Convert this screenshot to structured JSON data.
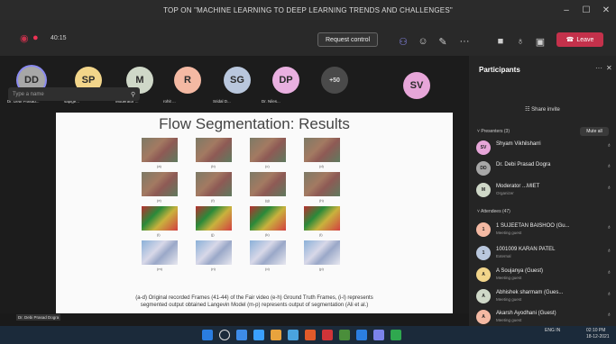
{
  "window": {
    "title": "TOP ON \"MACHINE LEARNING TO DEEP LEARNING TRENDS AND CHALLENGES\"",
    "minimize": "–",
    "maximize": "☐",
    "close": "✕"
  },
  "toolbar": {
    "timer": "40:15",
    "request_control": "Request control",
    "leave_label": "Leave",
    "more": "···"
  },
  "avatars": [
    {
      "initials": "DD",
      "name": "Dr. Debi Prasad...",
      "color": "#a7a7a7"
    },
    {
      "initials": "SP",
      "name": "sapige...",
      "color": "#f2d58a"
    },
    {
      "initials": "M",
      "name": "Moderator ...",
      "color": "#cfd8c8"
    },
    {
      "initials": "R",
      "name": "rohit ...",
      "color": "#f4b9a3"
    },
    {
      "initials": "SG",
      "name": "Sridal D...",
      "color": "#b9c7dd"
    },
    {
      "initials": "DP",
      "name": "Dr. Niles...",
      "color": "#e9b0e0"
    },
    {
      "initials": "+50",
      "name": "",
      "color": "#4a4a4a"
    },
    {
      "initials": "SV",
      "name": "",
      "color": "#e7a6d9"
    }
  ],
  "slide": {
    "title": "Flow Segmentation: Results",
    "labels": [
      "(a)",
      "(b)",
      "(c)",
      "(d)",
      "(e)",
      "(f)",
      "(g)",
      "(h)",
      "(i)",
      "(j)",
      "(k)",
      "(l)",
      "(m)",
      "(n)",
      "(o)",
      "(p)"
    ],
    "caption_line1": "(a-d) Original recorded Frames (41-44) of the Fair video (e-h) Ground Truth Frames, (i-l) represents",
    "caption_line2": "segmented output obtained Langevin Model (m-p) represents output of segmentation (Ali et al.)"
  },
  "speaker_tag": "Dr. Debi Prasad Dogra",
  "participants": {
    "title": "Participants",
    "search_placeholder": "Type a name",
    "share_invite": "Share invite",
    "presenters_header": "Presenters (3)",
    "mute_all": "Mute all",
    "attendees_header": "Attendees (47)",
    "presenters": [
      {
        "initials": "SV",
        "name": "Shyam Vikhilsharri",
        "role": "",
        "color": "#e7a6d9"
      },
      {
        "initials": "DD",
        "name": "Dr. Debi Prasad Dogra",
        "role": "",
        "color": "#a7a7a7"
      },
      {
        "initials": "M",
        "name": "Moderator ...MIET",
        "role": "Organizer",
        "color": "#cfd8c8"
      }
    ],
    "attendees": [
      {
        "initials": "1",
        "name": "1 SUJEETAN BAISHOO (Gu...",
        "role": "Meeting guest",
        "color": "#f4b9a3"
      },
      {
        "initials": "1",
        "name": "1001009 KARAN PATEL",
        "role": "External",
        "color": "#b9c7dd"
      },
      {
        "initials": "A",
        "name": "A Soujanya (Guest)",
        "role": "Meeting guest",
        "color": "#f2d58a"
      },
      {
        "initials": "A",
        "name": "Abhishek sharmam (Gues...",
        "role": "Meeting guest",
        "color": "#cfd8c8"
      },
      {
        "initials": "A",
        "name": "Akarsh Ayodhani (Guest)",
        "role": "Meeting guest",
        "color": "#f4b9a3"
      }
    ]
  },
  "taskbar": {
    "time": "02:10 PM",
    "date": "18-12-2021",
    "lang": "ENG IN"
  }
}
